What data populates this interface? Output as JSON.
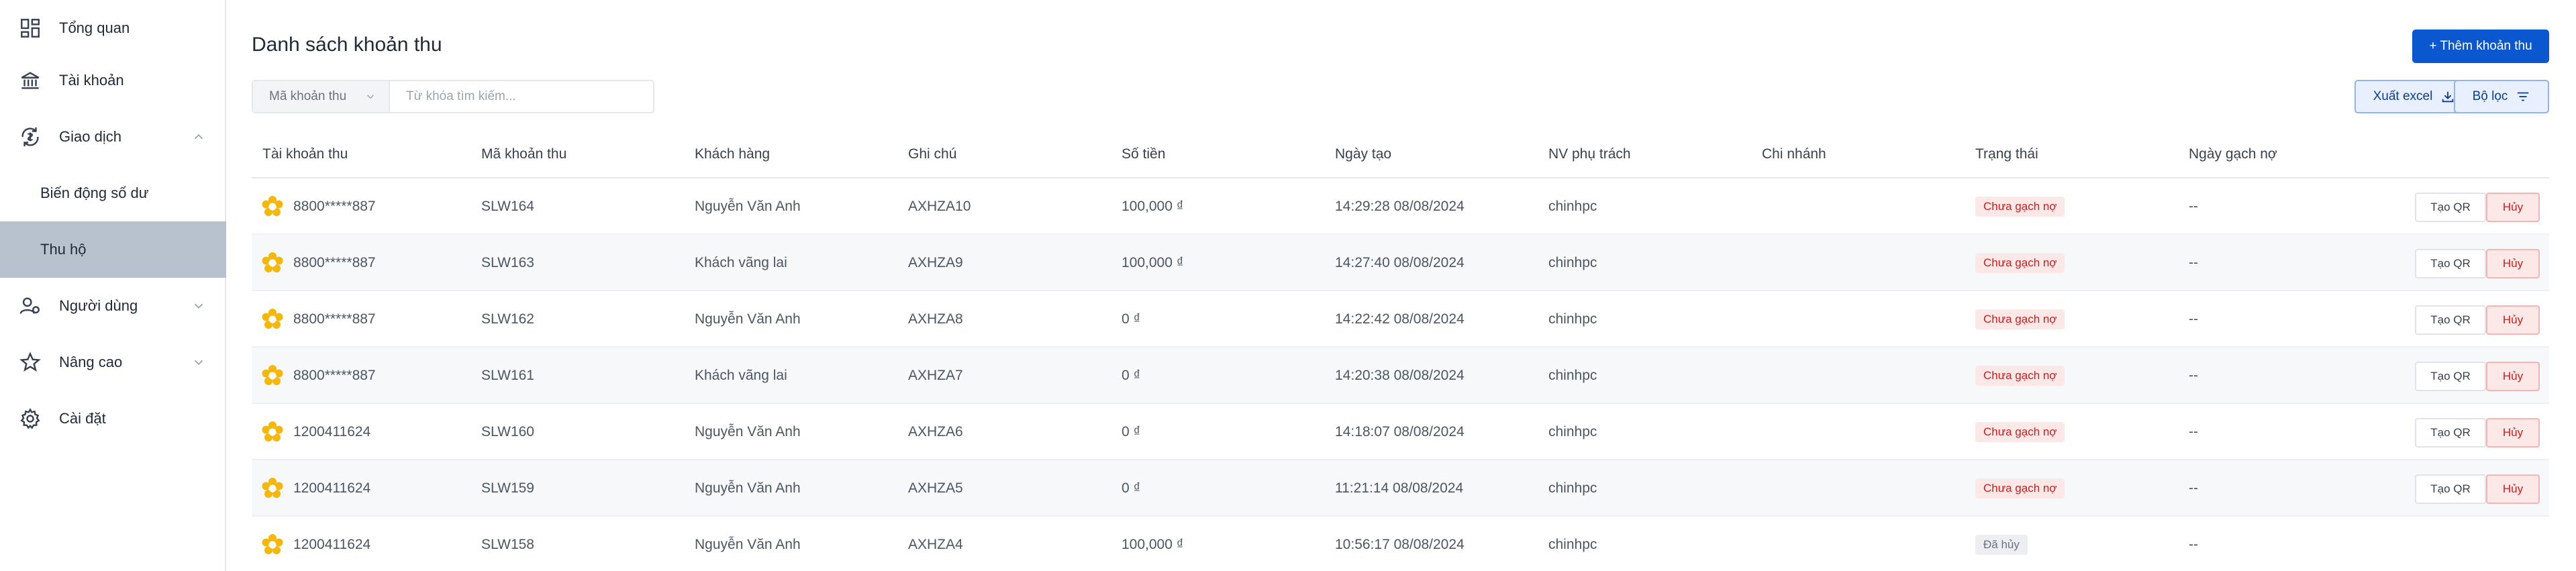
{
  "sidebar": {
    "items": [
      {
        "label": "Tổng quan"
      },
      {
        "label": "Tài khoản"
      },
      {
        "label": "Giao dịch"
      },
      {
        "label": "Biến động số dư"
      },
      {
        "label": "Thu hộ"
      },
      {
        "label": "Người dùng"
      },
      {
        "label": "Nâng cao"
      },
      {
        "label": "Cài đặt"
      }
    ]
  },
  "header": {
    "title": "Danh sách khoản thu",
    "add_button": "+ Thêm khoản thu"
  },
  "toolbar": {
    "search_field_select": "Mã khoản thu",
    "search_placeholder": "Từ khóa tìm kiếm...",
    "export_label": "Xuất excel",
    "filter_label": "Bộ lọc"
  },
  "table": {
    "columns": [
      "Tài khoản thu",
      "Mã khoản thu",
      "Khách hàng",
      "Ghi chú",
      "Số tiền",
      "Ngày tạo",
      "NV phụ trách",
      "Chi nhánh",
      "Trạng thái",
      "Ngày gạch nợ"
    ],
    "qr_label": "Tạo QR",
    "cancel_label": "Hủy",
    "rows": [
      {
        "account": "8800*****887",
        "code": "SLW164",
        "customer": "Nguyễn Văn Anh",
        "note": "AXHZA10",
        "amount": "100,000 ₫",
        "created": "14:29:28 08/08/2024",
        "staff": "chinhpc",
        "branch": "",
        "status": "Chưa gạch nợ",
        "paid_date": "--"
      },
      {
        "account": "8800*****887",
        "code": "SLW163",
        "customer": "Khách vãng lai",
        "note": "AXHZA9",
        "amount": "100,000 ₫",
        "created": "14:27:40 08/08/2024",
        "staff": "chinhpc",
        "branch": "",
        "status": "Chưa gạch nợ",
        "paid_date": "--"
      },
      {
        "account": "8800*****887",
        "code": "SLW162",
        "customer": "Nguyễn Văn Anh",
        "note": "AXHZA8",
        "amount": "0 ₫",
        "created": "14:22:42 08/08/2024",
        "staff": "chinhpc",
        "branch": "",
        "status": "Chưa gạch nợ",
        "paid_date": "--"
      },
      {
        "account": "8800*****887",
        "code": "SLW161",
        "customer": "Khách vãng lai",
        "note": "AXHZA7",
        "amount": "0 ₫",
        "created": "14:20:38 08/08/2024",
        "staff": "chinhpc",
        "branch": "",
        "status": "Chưa gạch nợ",
        "paid_date": "--"
      },
      {
        "account": "1200411624",
        "code": "SLW160",
        "customer": "Nguyễn Văn Anh",
        "note": "AXHZA6",
        "amount": "0 ₫",
        "created": "14:18:07 08/08/2024",
        "staff": "chinhpc",
        "branch": "",
        "status": "Chưa gạch nợ",
        "paid_date": "--"
      },
      {
        "account": "1200411624",
        "code": "SLW159",
        "customer": "Nguyễn Văn Anh",
        "note": "AXHZA5",
        "amount": "0 ₫",
        "created": "11:21:14 08/08/2024",
        "staff": "chinhpc",
        "branch": "",
        "status": "Chưa gạch nợ",
        "paid_date": "--"
      },
      {
        "account": "1200411624",
        "code": "SLW158",
        "customer": "Nguyễn Văn Anh",
        "note": "AXHZA4",
        "amount": "100,000 ₫",
        "created": "10:56:17 08/08/2024",
        "staff": "chinhpc",
        "branch": "",
        "status": "Đã hủy",
        "paid_date": "--"
      }
    ]
  },
  "colors": {
    "primary": "#0b57d0",
    "active_nav": "#b8c2cf",
    "status_red_bg": "#fde8e8",
    "status_red_text": "#c81e1e",
    "status_gray_bg": "#eceef1",
    "logo_yellow": "#f5b70a"
  }
}
